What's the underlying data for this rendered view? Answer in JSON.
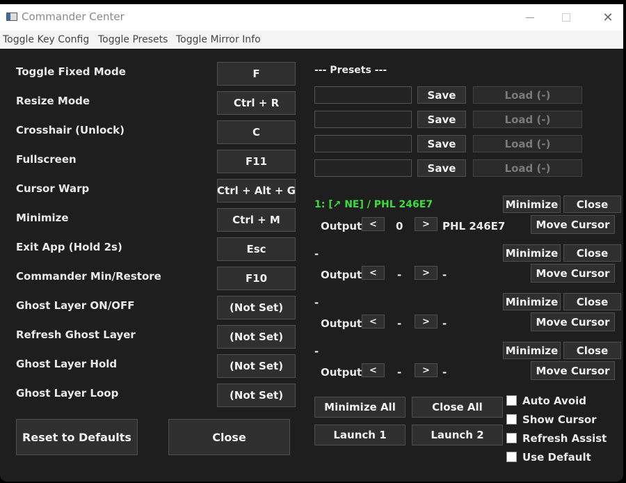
{
  "window": {
    "title": "Commander Center",
    "close_glyph": "✕"
  },
  "menu": [
    "Toggle Key Config",
    "Toggle Presets",
    "Toggle Mirror Info"
  ],
  "keybinds": [
    {
      "label": "Toggle Fixed Mode",
      "key": "F"
    },
    {
      "label": "Resize Mode",
      "key": "Ctrl + R"
    },
    {
      "label": "Crosshair (Unlock)",
      "key": "C"
    },
    {
      "label": "Fullscreen",
      "key": "F11"
    },
    {
      "label": "Cursor Warp",
      "key": "Ctrl + Alt + G"
    },
    {
      "label": "Minimize",
      "key": "Ctrl + M"
    },
    {
      "label": "Exit App (Hold 2s)",
      "key": "Esc"
    },
    {
      "label": "Commander Min/Restore",
      "key": "F10"
    },
    {
      "label": "Ghost Layer ON/OFF",
      "key": "(Not Set)"
    },
    {
      "label": "Refresh Ghost Layer",
      "key": "(Not Set)"
    },
    {
      "label": "Ghost Layer Hold",
      "key": "(Not Set)"
    },
    {
      "label": "Ghost Layer Loop",
      "key": "(Not Set)"
    }
  ],
  "footer": {
    "reset_label": "Reset to Defaults",
    "close_label": "Close"
  },
  "presets": {
    "header": "--- Presets ---",
    "save_label": "Save",
    "load_label": "Load (-)",
    "slots": [
      "",
      "",
      "",
      ""
    ]
  },
  "targets": [
    {
      "title": "1: [↗ NE] / PHL 246E7",
      "output_label": "Output",
      "value": "0",
      "name": "PHL 246E7"
    },
    {
      "title": "-",
      "output_label": "Output",
      "value": "-",
      "name": "-"
    },
    {
      "title": "-",
      "output_label": "Output",
      "value": "-",
      "name": "-"
    },
    {
      "title": "-",
      "output_label": "Output",
      "value": "-",
      "name": "-"
    }
  ],
  "target_buttons": {
    "minimize": "Minimize",
    "close": "Close",
    "move_cursor": "Move Cursor",
    "prev": "<",
    "next": ">"
  },
  "bottom_buttons": {
    "minimize_all": "Minimize All",
    "close_all": "Close All",
    "launch1": "Launch 1",
    "launch2": "Launch 2"
  },
  "options": [
    {
      "label": "Auto Avoid",
      "checked": false
    },
    {
      "label": "Show Cursor",
      "checked": false
    },
    {
      "label": "Refresh Assist",
      "checked": false
    },
    {
      "label": "Use Default",
      "checked": false
    }
  ],
  "colors": {
    "background": "#1e1e1e",
    "button": "#2f2f2f",
    "target_title": "#3ddc3d"
  }
}
